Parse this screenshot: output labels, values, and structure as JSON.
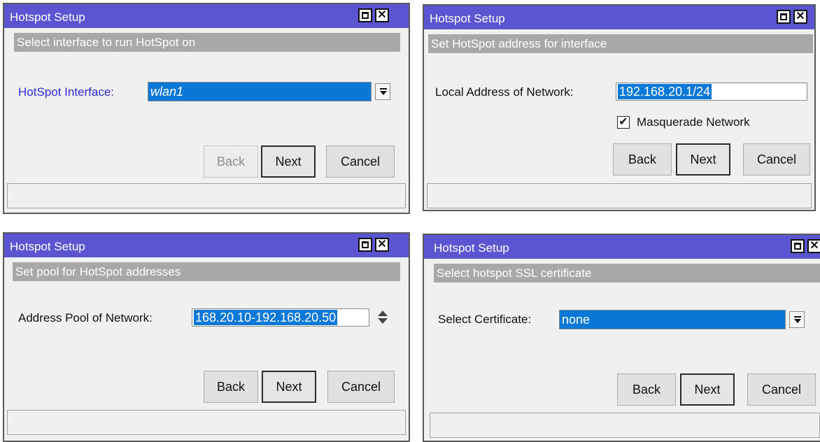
{
  "dialogs": [
    {
      "title": "Hotspot Setup",
      "header": "Select interface to run HotSpot on",
      "field_label": "HotSpot Interface:",
      "field_value": "wlan1",
      "buttons": {
        "back": "Back",
        "next": "Next",
        "cancel": "Cancel"
      }
    },
    {
      "title": "Hotspot Setup",
      "header": "Set HotSpot address for interface",
      "field_label": "Local Address of Network:",
      "field_value": "192.168.20.1/24",
      "checkbox_label": "Masquerade Network",
      "checkbox_checked": true,
      "buttons": {
        "back": "Back",
        "next": "Next",
        "cancel": "Cancel"
      }
    },
    {
      "title": "Hotspot Setup",
      "header": "Set pool for HotSpot addresses",
      "field_label": "Address Pool of Network:",
      "field_value": "168.20.10-192.168.20.50",
      "buttons": {
        "back": "Back",
        "next": "Next",
        "cancel": "Cancel"
      }
    },
    {
      "title": "Hotspot Setup",
      "header": "Select hotspot SSL certificate",
      "field_label": "Select Certificate:",
      "field_value": "none",
      "buttons": {
        "back": "Back",
        "next": "Next",
        "cancel": "Cancel"
      }
    }
  ],
  "icons": {
    "maximize": "maximize-icon",
    "close": "close-icon",
    "dropdown": "dropdown-arrow-icon",
    "spinner": "spinner-icon",
    "check": "checkmark-icon"
  },
  "colors": {
    "titlebar": "#5b55d2",
    "section_header": "#a8a8a8",
    "selection": "#0a78d7",
    "label_highlight": "#2b2bd9"
  }
}
